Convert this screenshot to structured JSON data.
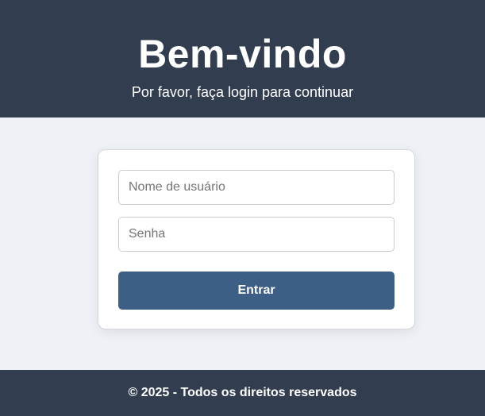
{
  "header": {
    "title": "Bem-vindo",
    "subtitle": "Por favor, faça login para continuar"
  },
  "login_form": {
    "username": {
      "value": "",
      "placeholder": "Nome de usuário"
    },
    "password": {
      "value": "",
      "placeholder": "Senha"
    },
    "submit_label": "Entrar"
  },
  "footer": {
    "text": "© 2025 - Todos os direitos reservados"
  },
  "colors": {
    "header_bg": "#323d50",
    "page_bg": "#eef1f6",
    "button_bg": "#3d5f85",
    "text_light": "#ffffff"
  }
}
